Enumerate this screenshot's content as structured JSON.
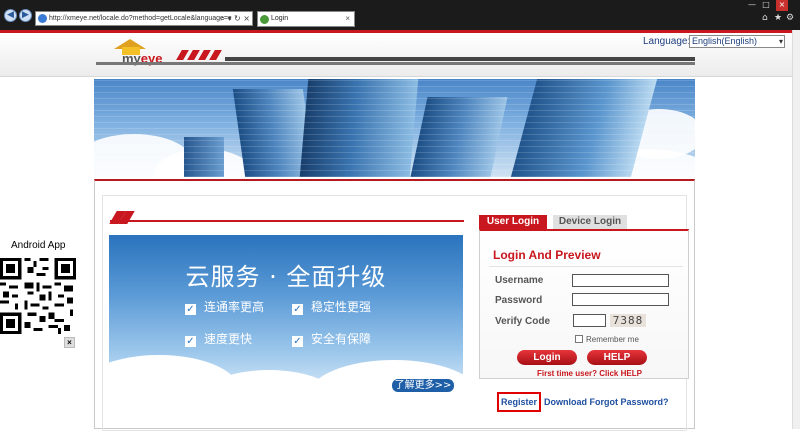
{
  "browser": {
    "address": "http://xmeye.net/locale.do?method=getLocale&language=c",
    "address_controls": "⌕ ▾ ↻ ×",
    "tab_title": "Login",
    "tab_close": "×",
    "win_min": "—",
    "win_max": "□",
    "win_close": "×",
    "home": "⌂",
    "star": "★",
    "gear": "⚙"
  },
  "header": {
    "logo_text": "my",
    "logo_accent": "eye",
    "language_label": "Language:",
    "language_value": "English(English)",
    "dropdown_arrow": "▾"
  },
  "ad": {
    "title": "云服务 · 全面升级",
    "features": [
      "连通率更高",
      "稳定性更强",
      "速度更快",
      "安全有保障"
    ],
    "check": "✓",
    "more_label": "了解更多>>"
  },
  "login": {
    "tab_user": "User Login",
    "tab_device": "Device Login",
    "title": "Login And Preview",
    "username_label": "Username",
    "password_label": "Password",
    "verify_label": "Verify Code",
    "captcha": "7388",
    "remember_label": "Remember me",
    "login_button": "Login",
    "help_button": "HELP",
    "first_time": "First time user? Click HELP",
    "register": "Register",
    "download": "Download Forgot Password?"
  },
  "android": {
    "label": "Android App",
    "close": "×"
  },
  "colors": {
    "brand_red": "#c8171e",
    "link_blue": "#1f4fa0",
    "ad_blue": "#2a73bd"
  }
}
